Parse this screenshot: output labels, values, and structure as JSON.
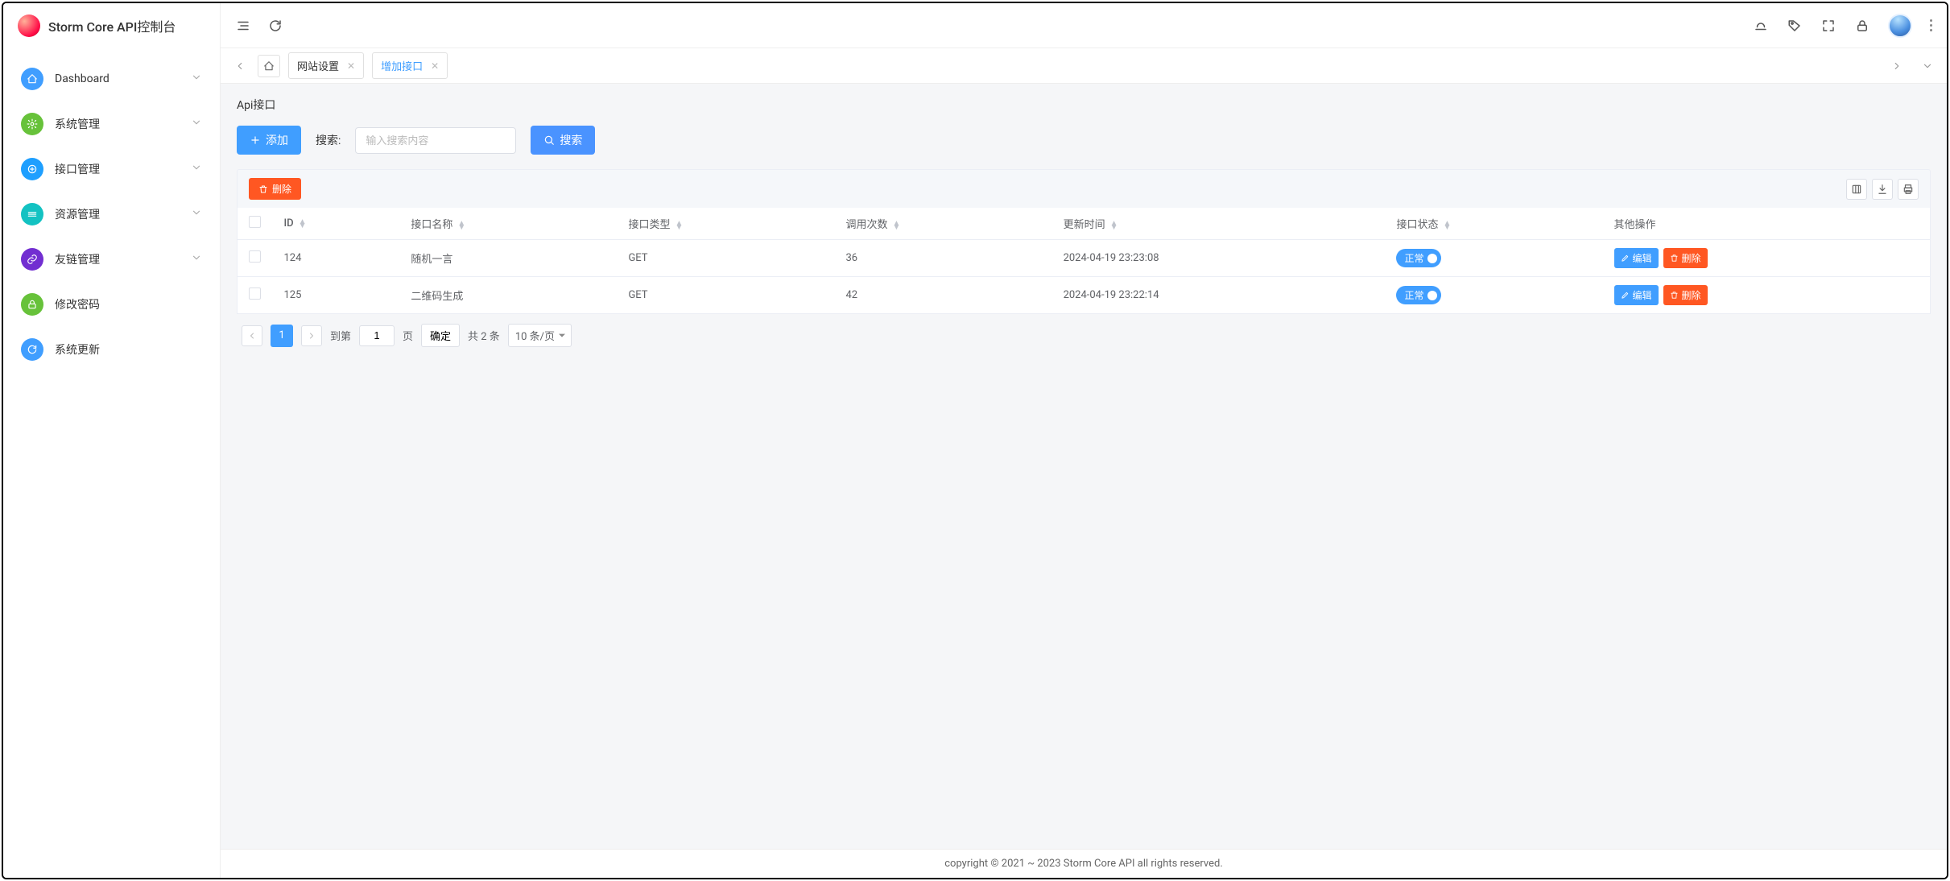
{
  "app": {
    "title": "Storm Core API控制台"
  },
  "sidebar": {
    "items": [
      {
        "label": "Dashboard",
        "expandable": true
      },
      {
        "label": "系统管理",
        "expandable": true
      },
      {
        "label": "接口管理",
        "expandable": true
      },
      {
        "label": "资源管理",
        "expandable": true
      },
      {
        "label": "友链管理",
        "expandable": true
      },
      {
        "label": "修改密码",
        "expandable": false
      },
      {
        "label": "系统更新",
        "expandable": false
      }
    ]
  },
  "tabs": [
    {
      "label": "网站设置",
      "active": false
    },
    {
      "label": "增加接口",
      "active": true
    }
  ],
  "panel": {
    "title": "Api接口",
    "add_label": "添加",
    "search_label": "搜索:",
    "search_placeholder": "输入搜索内容",
    "search_btn": "搜索",
    "batch_delete": "删除"
  },
  "table": {
    "columns": [
      "ID",
      "接口名称",
      "接口类型",
      "调用次数",
      "更新时间",
      "接口状态",
      "其他操作"
    ],
    "rows": [
      {
        "id": "124",
        "name": "随机一言",
        "type": "GET",
        "count": "36",
        "updated": "2024-04-19 23:23:08",
        "status": "正常"
      },
      {
        "id": "125",
        "name": "二维码生成",
        "type": "GET",
        "count": "42",
        "updated": "2024-04-19 23:22:14",
        "status": "正常"
      }
    ],
    "edit_label": "编辑",
    "delete_label": "删除"
  },
  "pagination": {
    "current": "1",
    "goto_label": "到第",
    "goto_value": "1",
    "page_label": "页",
    "confirm": "确定",
    "total": "共 2 条",
    "per_page": "10 条/页"
  },
  "footer": {
    "text": "copyright © 2021 ~ 2023 Storm Core API all rights reserved."
  }
}
